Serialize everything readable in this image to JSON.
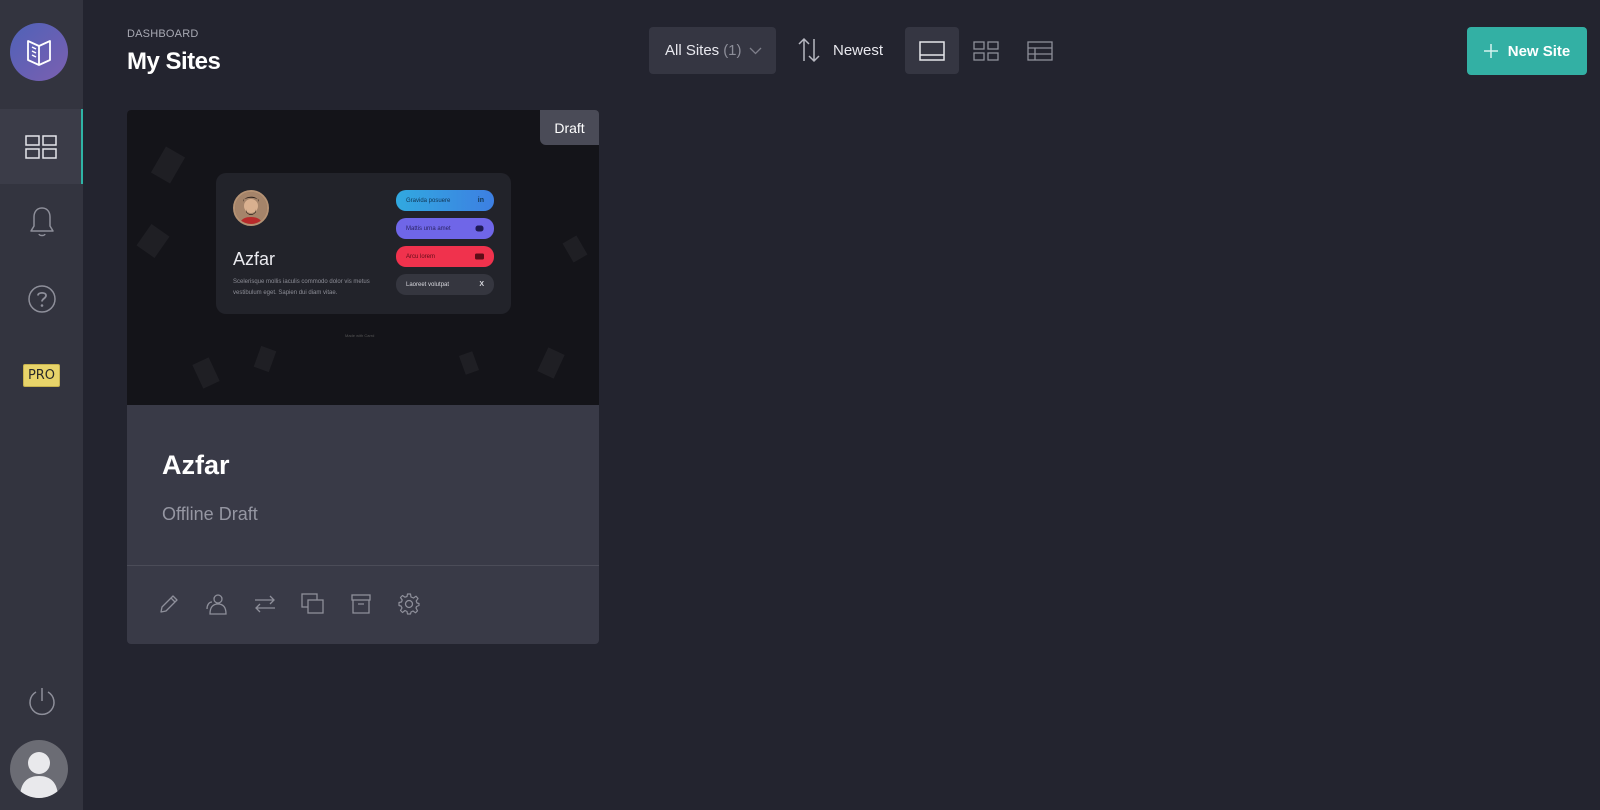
{
  "header": {
    "breadcrumb": "DASHBOARD",
    "title": "My Sites"
  },
  "toolbar": {
    "filter_label": "All Sites",
    "filter_count": "(1)",
    "sort_label": "Newest",
    "new_site_label": "New Site"
  },
  "sidebar": {
    "pro_label": "PRO",
    "items": [
      "grid-icon",
      "bell-icon",
      "help-icon",
      "pro-badge"
    ]
  },
  "sites": [
    {
      "badge": "Draft",
      "name": "Azfar",
      "status": "Offline Draft",
      "preview": {
        "name": "Azfar",
        "description": "Scelerisque mollis iaculis commodo dolor vis metus vestibulum eget. Sapien dui diam vitae.",
        "links": [
          {
            "label": "Gravida posuere",
            "icon": "in"
          },
          {
            "label": "Mattis urna amet",
            "icon": "discord"
          },
          {
            "label": "Arcu lorem",
            "icon": "youtube"
          },
          {
            "label": "Laoreet volutpat",
            "icon": "X"
          }
        ],
        "footer": "Made with Carrd"
      }
    }
  ],
  "colors": {
    "accent": "#33b0a4",
    "sidebar": "#33343f",
    "background": "#23242f",
    "card": "#393a47",
    "pro": "#e8d46a"
  }
}
